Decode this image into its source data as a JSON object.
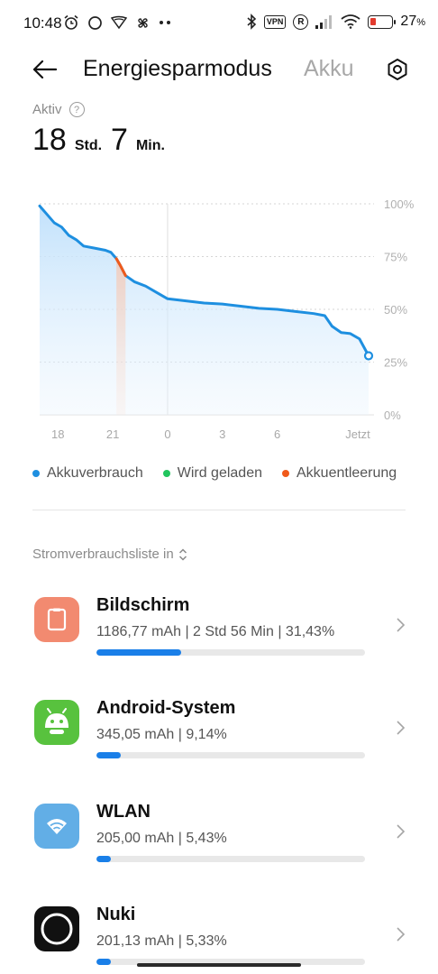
{
  "status_bar": {
    "time": "10:48",
    "vpn": "VPN",
    "roaming": "R",
    "battery_percent": "27",
    "battery_unit": "%",
    "battery_level": 0.27,
    "icons": [
      "alarm-icon",
      "circle-icon",
      "fan-icon",
      "pinwheel-icon",
      "more-dots-icon",
      "bluetooth-icon",
      "vpn-icon",
      "roaming-icon",
      "signal-icon",
      "wifi-icon",
      "battery-icon"
    ]
  },
  "header": {
    "title": "Energiesparmodus",
    "secondary_tab": "Akku",
    "back_icon": "back-arrow-icon",
    "settings_icon": "settings-icon"
  },
  "active": {
    "label": "Aktiv",
    "help": "?",
    "hours": "18",
    "hours_unit": "Std.",
    "minutes": "7",
    "minutes_unit": "Min."
  },
  "chart_data": {
    "type": "area",
    "x_ticks": [
      "18",
      "21",
      "0",
      "3",
      "6",
      "Jetzt"
    ],
    "y_ticks": [
      "100%",
      "75%",
      "50%",
      "25%",
      "0%"
    ],
    "ylim": [
      0,
      100
    ],
    "xlim": [
      17,
      35
    ],
    "grid": true,
    "legend_position": "bottom",
    "series": [
      {
        "name": "Akkuverbrauch",
        "color": "#1e8fe0",
        "points": [
          [
            17.0,
            99
          ],
          [
            17.4,
            95
          ],
          [
            17.8,
            91
          ],
          [
            18.2,
            89
          ],
          [
            18.6,
            85
          ],
          [
            19.0,
            83
          ],
          [
            19.4,
            80
          ],
          [
            20.0,
            79
          ],
          [
            20.6,
            78
          ],
          [
            20.9,
            77
          ],
          [
            21.2,
            74
          ],
          [
            21.4,
            71
          ],
          [
            21.7,
            66
          ],
          [
            22.2,
            63
          ],
          [
            22.8,
            61
          ],
          [
            23.4,
            58
          ],
          [
            24.0,
            55
          ],
          [
            25.0,
            54
          ],
          [
            26.0,
            53
          ],
          [
            27.0,
            52.5
          ],
          [
            28.0,
            51.5
          ],
          [
            29.0,
            50.5
          ],
          [
            30.0,
            50
          ],
          [
            31.0,
            49
          ],
          [
            32.0,
            48
          ],
          [
            32.6,
            47
          ],
          [
            33.0,
            42
          ],
          [
            33.5,
            39
          ],
          [
            34.0,
            38.5
          ],
          [
            34.5,
            36
          ],
          [
            35.0,
            28
          ]
        ]
      },
      {
        "name": "Wird geladen",
        "color": "#22c55e",
        "points": []
      },
      {
        "name": "Akkuentleerung",
        "color": "#f05a1a",
        "points": [
          [
            21.2,
            74
          ],
          [
            21.4,
            71
          ],
          [
            21.7,
            66
          ]
        ]
      }
    ]
  },
  "list_header": {
    "label": "Stromverbrauchsliste in"
  },
  "usage_items": [
    {
      "name": "Bildschirm",
      "detail": "1186,77 mAh | 2 Std 56 Min  | 31,43%",
      "percent": 31.43,
      "icon": "screen-icon",
      "icon_color": "#f28a70"
    },
    {
      "name": "Android-System",
      "detail": "345,05 mAh | 9,14%",
      "percent": 9.14,
      "icon": "android-icon",
      "icon_color": "#58c23e"
    },
    {
      "name": "WLAN",
      "detail": "205,00 mAh | 5,43%",
      "percent": 5.43,
      "icon": "wifi-app-icon",
      "icon_color": "#62aee6"
    },
    {
      "name": "Nuki",
      "detail": "201,13 mAh | 5,33%",
      "percent": 5.33,
      "icon": "nuki-icon",
      "icon_color": "#111111"
    }
  ]
}
